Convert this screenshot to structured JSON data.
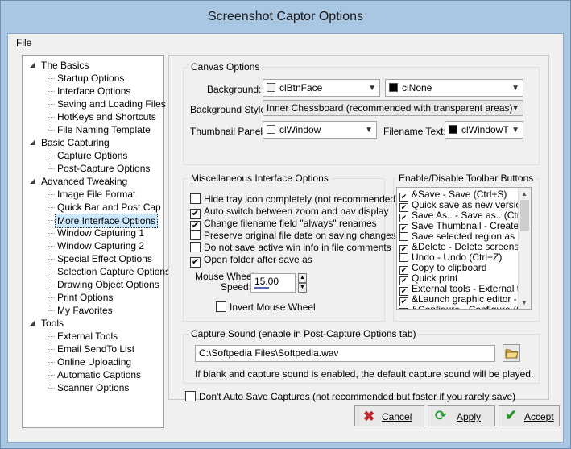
{
  "window": {
    "title": "Screenshot Captor Options"
  },
  "menu": {
    "file": "File"
  },
  "tree": [
    {
      "label": "The Basics",
      "level": 0
    },
    {
      "label": "Startup Options",
      "level": 1
    },
    {
      "label": "Interface Options",
      "level": 1
    },
    {
      "label": "Saving and Loading Files",
      "level": 1
    },
    {
      "label": "HotKeys and Shortcuts",
      "level": 1
    },
    {
      "label": "File Naming Template",
      "level": 1
    },
    {
      "label": "Basic Capturing",
      "level": 0
    },
    {
      "label": "Capture Options",
      "level": 1
    },
    {
      "label": "Post-Capture Options",
      "level": 1
    },
    {
      "label": "Advanced Tweaking",
      "level": 0
    },
    {
      "label": "Image File Format",
      "level": 1
    },
    {
      "label": "Quick Bar and Post Cap",
      "level": 1
    },
    {
      "label": "More Interface Options",
      "level": 1
    },
    {
      "label": "Window Capturing 1",
      "level": 1
    },
    {
      "label": "Window Capturing 2",
      "level": 1
    },
    {
      "label": "Special Effect Options",
      "level": 1
    },
    {
      "label": "Selection Capture Options",
      "level": 1
    },
    {
      "label": "Drawing Object Options",
      "level": 1
    },
    {
      "label": "Print Options",
      "level": 1
    },
    {
      "label": "My Favorites",
      "level": 1
    },
    {
      "label": "Tools",
      "level": 0
    },
    {
      "label": "External Tools",
      "level": 1
    },
    {
      "label": "Email SendTo List",
      "level": 1
    },
    {
      "label": "Online Uploading",
      "level": 1
    },
    {
      "label": "Automatic Captions",
      "level": 1
    },
    {
      "label": "Scanner Options",
      "level": 1
    }
  ],
  "canvas": {
    "title": "Canvas Options",
    "background_label": "Background:",
    "background_value": "clBtnFace",
    "background2_value": "clNone",
    "style_label": "Background Style",
    "style_value": "Inner Chessboard (recommended with transparent areas)",
    "thumb_label": "Thumbnail Panel:",
    "thumb_value": "clWindow",
    "filename_label": "Filename Text:",
    "filename_value": "clWindowT"
  },
  "misc": {
    "title": "Miscellaneous Interface Options",
    "options": [
      {
        "label": "Hide tray icon completely (not recommended)",
        "checked": false
      },
      {
        "label": "Auto switch between zoom and nav display",
        "checked": true
      },
      {
        "label": "Change filename field \"always\" renames",
        "checked": true
      },
      {
        "label": "Preserve original file date on saving changes",
        "checked": false
      },
      {
        "label": "Do not save active win info in file comments",
        "checked": false
      },
      {
        "label": "Open folder after save as",
        "checked": true
      }
    ],
    "wheel_label_1": "Mouse Wheel",
    "wheel_label_2": "Speed:",
    "wheel_value": "15.00",
    "invert_label": "Invert Mouse Wheel"
  },
  "toolbar": {
    "title": "Enable/Disable Toolbar Buttons",
    "items": [
      {
        "label": "&Save - Save (Ctrl+S)",
        "checked": true
      },
      {
        "label": "Quick save as new version",
        "checked": true
      },
      {
        "label": "Save As.. - Save as.. (Ctrl+",
        "checked": true
      },
      {
        "label": "Save Thumbnail - Create th",
        "checked": true
      },
      {
        "label": "Save selected region as ne",
        "checked": false
      },
      {
        "label": "&Delete - Delete screensho",
        "checked": true
      },
      {
        "label": "Undo - Undo (Ctrl+Z)",
        "checked": false
      },
      {
        "label": "Copy to clipboard",
        "checked": true
      },
      {
        "label": "Quick print",
        "checked": true
      },
      {
        "label": "External tools - External too",
        "checked": true
      },
      {
        "label": "&Launch graphic editor - La",
        "checked": true
      },
      {
        "label": "&Configure - Configure (Ctrl",
        "checked": true
      }
    ]
  },
  "sound": {
    "title": "Capture Sound (enable in Post-Capture Options tab)",
    "path": "C:\\Softpedia Files\\Softpedia.wav",
    "hint": "If blank and capture sound is enabled, the default capture sound will be played."
  },
  "dont_autosave": {
    "label": "Don't Auto Save Captures (not recommended but faster if you rarely save)",
    "checked": false
  },
  "buttons": {
    "cancel": "Cancel",
    "apply": "Apply",
    "accept": "Accept"
  },
  "colors": {
    "accent": "#a9c6e3",
    "cancel_icon": "#c0282d",
    "apply_icon": "#2f9a3c",
    "accept_icon": "#2d8f2d"
  }
}
